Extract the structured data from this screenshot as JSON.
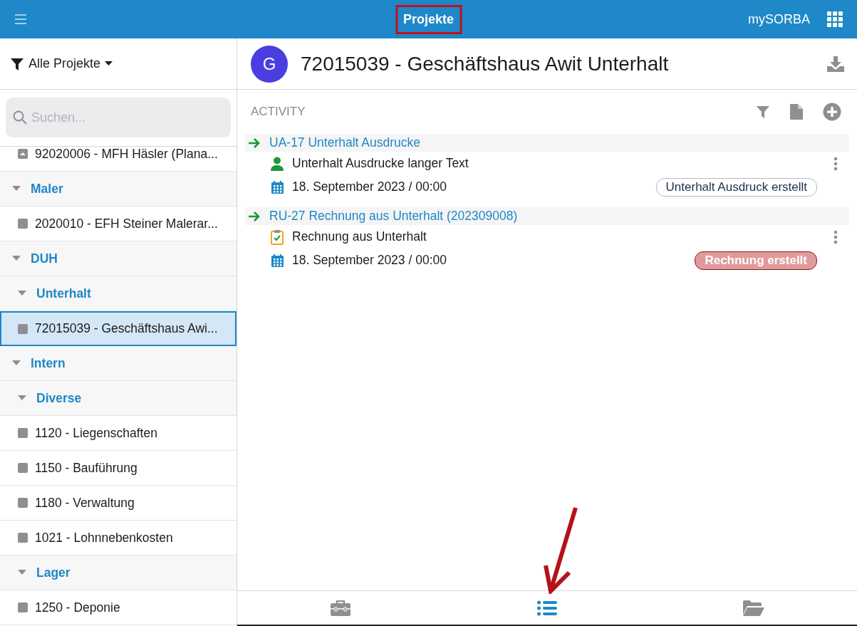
{
  "header": {
    "title": "Projekte",
    "title_highlighted": true,
    "brand": "mySORBA"
  },
  "sidebar": {
    "filter": "Alle Projekte",
    "search": {
      "placeholder": "Suchen..."
    },
    "tree": [
      {
        "label": "92020006 - MFH Häsler (Plana...",
        "kind": "marked",
        "selected": false
      },
      {
        "label": "Maler",
        "kind": "group",
        "expanded": true,
        "children": [
          {
            "label": "2020010 - EFH Steiner Malerar...",
            "kind": "item",
            "selected": false
          }
        ]
      },
      {
        "label": "DUH",
        "kind": "group",
        "expanded": true,
        "children": [
          {
            "label": "Unterhalt",
            "kind": "group",
            "expanded": true,
            "children": [
              {
                "label": "72015039 - Geschäftshaus Awi...",
                "kind": "item",
                "selected": true
              }
            ]
          }
        ]
      },
      {
        "label": "Intern",
        "kind": "group",
        "expanded": true,
        "children": [
          {
            "label": "Diverse",
            "kind": "group",
            "expanded": true,
            "children": [
              {
                "label": "1120 - Liegenschaften",
                "kind": "item",
                "selected": false
              },
              {
                "label": "1150 - Bauführung",
                "kind": "item",
                "selected": false
              },
              {
                "label": "1180 - Verwaltung",
                "kind": "item",
                "selected": false
              },
              {
                "label": "1021 - Lohnnebenkosten",
                "kind": "item",
                "selected": false
              }
            ]
          },
          {
            "label": "Lager",
            "kind": "group",
            "expanded": true,
            "children": [
              {
                "label": "1250 - Deponie",
                "kind": "item",
                "selected": false
              }
            ]
          }
        ]
      }
    ]
  },
  "project": {
    "avatar": "G",
    "title": "72015039 - Geschäftshaus Awit Unterhalt"
  },
  "activity": {
    "heading": "ACTIVITY",
    "entries": [
      {
        "title": "UA-17 Unterhalt Ausdrucke",
        "kind": "person",
        "text": "Unterhalt Ausdrucke langer Text",
        "date": "18. September 2023 / 00:00",
        "status": {
          "label": "Unterhalt Ausdruck erstellt",
          "kind": "outline"
        }
      },
      {
        "title": "RU-27 Rechnung aus Unterhalt (202309008)",
        "kind": "task",
        "text": "Rechnung aus Unterhalt",
        "date": "18. September 2023 / 00:00",
        "status": {
          "label": "Rechnung erstellt",
          "kind": "danger"
        }
      }
    ]
  },
  "bottom_tabs": [
    {
      "kind": "toolbox",
      "selected": false
    },
    {
      "kind": "list",
      "selected": true
    },
    {
      "kind": "folder",
      "selected": false
    }
  ],
  "annotation_arrow": true
}
